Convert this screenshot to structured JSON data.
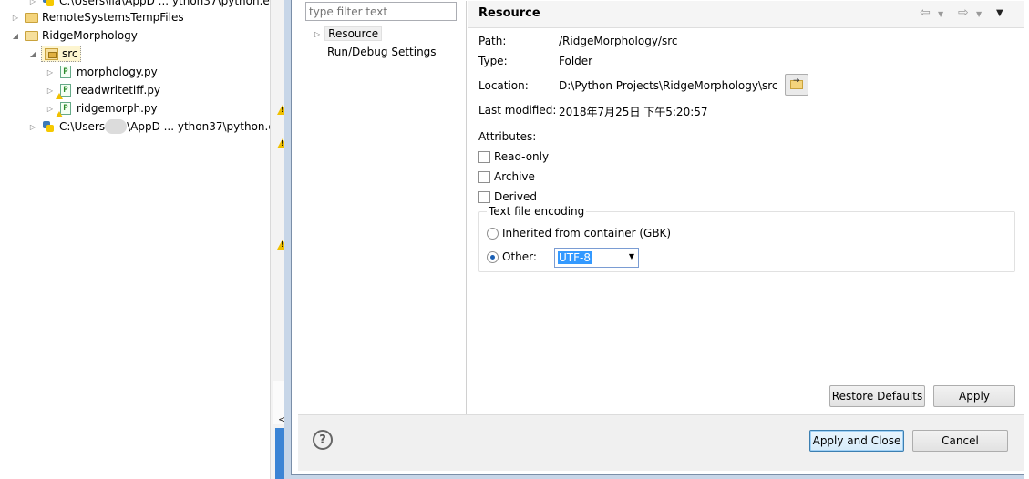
{
  "explorer": {
    "rows": [
      {
        "label": "C:\\Users\\lia\\AppD ... ython37\\python.e:"
      },
      {
        "label": "RemoteSystemsTempFiles"
      },
      {
        "label": "RidgeMorphology"
      },
      {
        "label": "src"
      },
      {
        "label": "morphology.py"
      },
      {
        "label": "readwritetiff.py"
      },
      {
        "label": "ridgemorph.py"
      },
      {
        "label_a": "C:\\Users",
        "label_b": "\\AppD ... ython37\\python.e:"
      }
    ]
  },
  "background": {
    "console_text": "<te"
  },
  "dialog": {
    "filter_placeholder": "type filter text",
    "nav": {
      "resource": "Resource",
      "run_debug": "Run/Debug Settings"
    },
    "page": {
      "title": "Resource",
      "properties": [
        {
          "label": "Path:",
          "value": "/RidgeMorphology/src"
        },
        {
          "label": "Type:",
          "value": "Folder"
        },
        {
          "label": "Location:",
          "value": "D:\\Python Projects\\RidgeMorphology\\src"
        },
        {
          "label": "Last modified:",
          "value": "2018年7月25日 下午5:20:57"
        }
      ],
      "attributes_label": "Attributes:",
      "checkboxes": [
        {
          "label": "Read-only",
          "checked": false
        },
        {
          "label": "Archive",
          "checked": false
        },
        {
          "label": "Derived",
          "checked": false
        }
      ],
      "encoding": {
        "legend": "Text file encoding",
        "inherited_label": "Inherited from container (GBK)",
        "other_label": "Other:",
        "selected": "other",
        "value": "UTF-8"
      },
      "restore_defaults": "Restore Defaults",
      "apply": "Apply"
    },
    "footer": {
      "help": "?",
      "apply_close": "Apply and Close",
      "cancel": "Cancel"
    }
  },
  "colors": {
    "selection_blue": "#3399ff",
    "dialog_frame": "#c7d6e8",
    "default_button_border": "#3c7fb1"
  }
}
